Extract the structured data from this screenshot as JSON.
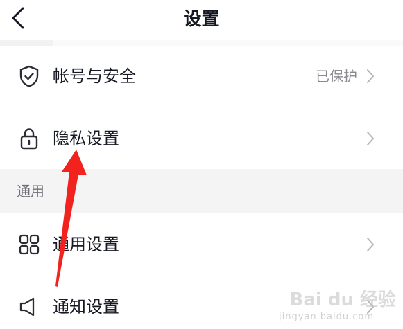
{
  "header": {
    "title": "设置"
  },
  "rows": {
    "account_security": {
      "label": "帐号与安全",
      "value": "已保护",
      "icon": "shield-check-icon"
    },
    "privacy": {
      "label": "隐私设置",
      "icon": "lock-icon"
    },
    "general": {
      "label": "通用设置",
      "icon": "grid-icon"
    },
    "notifications": {
      "label": "通知设置",
      "icon": "speaker-icon"
    }
  },
  "section": {
    "general_header": "通用"
  },
  "annotation": {
    "arrow_color": "#f2231e",
    "points_to": "privacy"
  },
  "watermark": {
    "text": "Bai du 经验",
    "sub": "jingyan.baidu.com"
  },
  "colors": {
    "text_primary": "#161823",
    "text_secondary": "#8a8b91",
    "section_bg": "#f4f4f4",
    "divider": "#ececec"
  }
}
